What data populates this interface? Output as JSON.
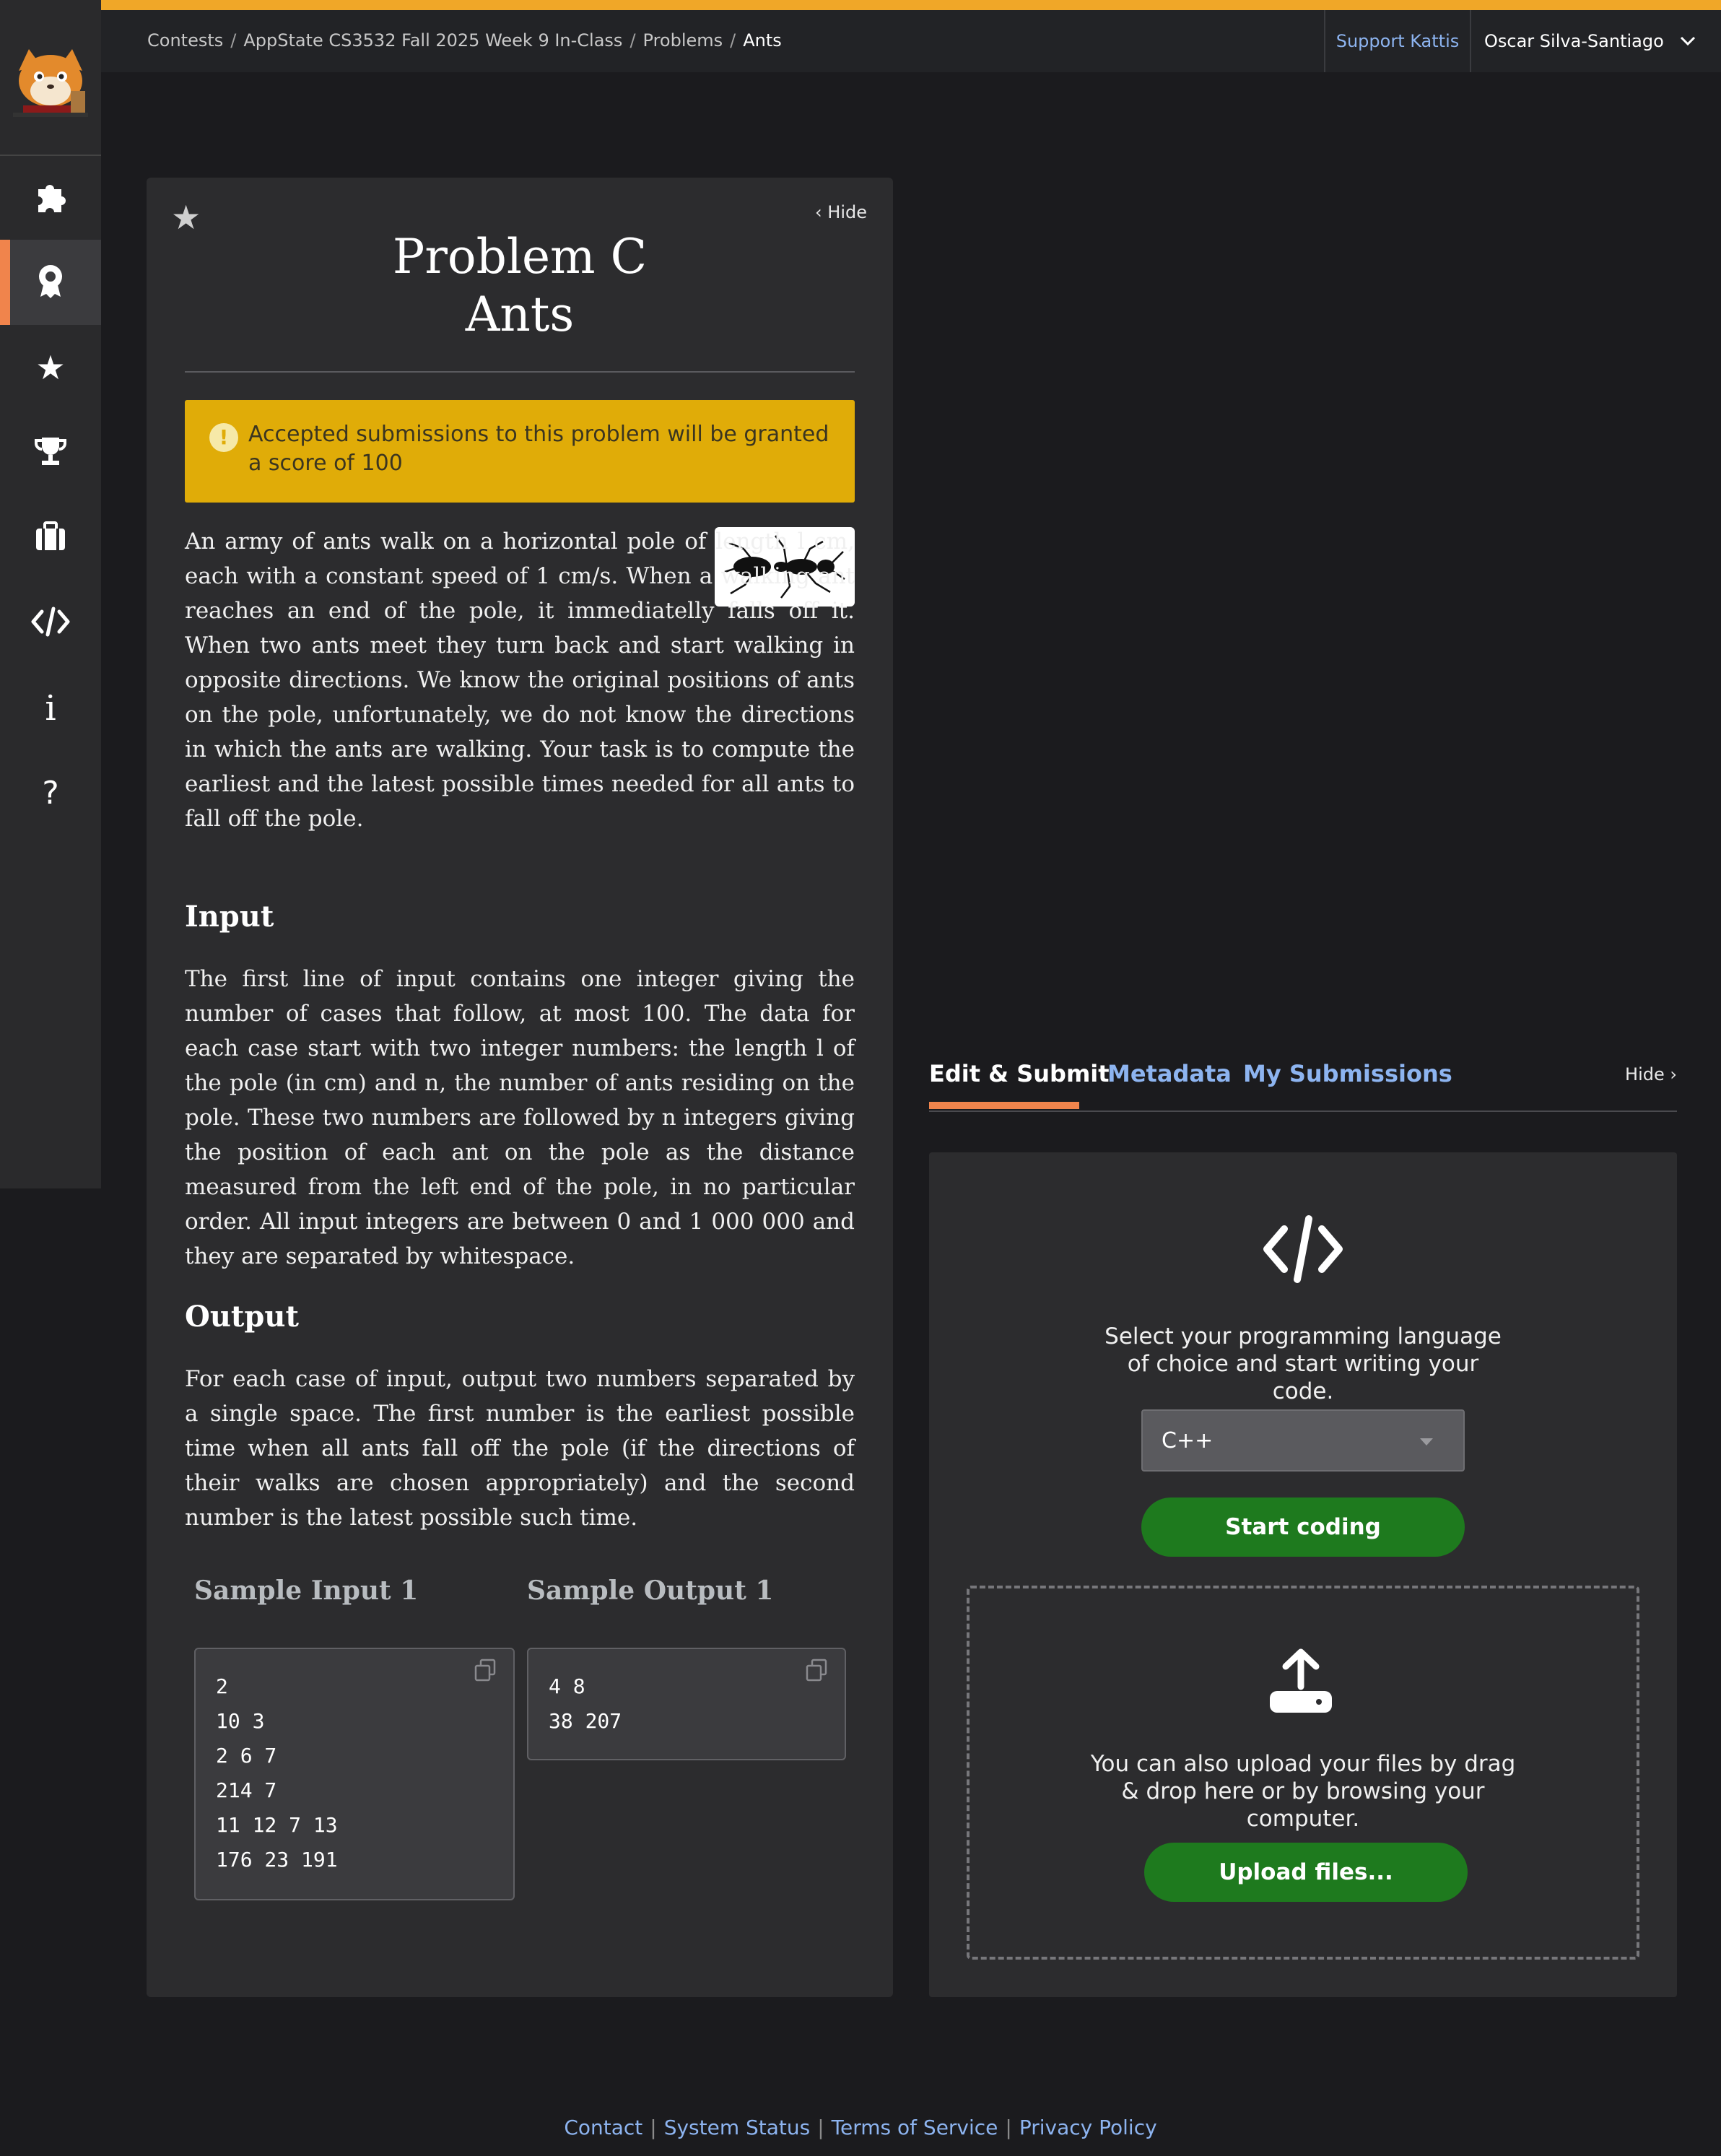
{
  "header": {
    "breadcrumbs": [
      "Contests",
      "AppState CS3532 Fall 2025 Week 9 In-Class",
      "Problems",
      "Ants"
    ],
    "support_label": "Support Kattis",
    "user_name": "Oscar Silva-Santiago",
    "accent_color": "#f0a728"
  },
  "sidebar": {
    "items": [
      {
        "icon": "puzzle-icon",
        "active": false
      },
      {
        "icon": "badge-icon",
        "active": true
      },
      {
        "icon": "star-icon",
        "active": false
      },
      {
        "icon": "trophy-icon",
        "active": false
      },
      {
        "icon": "briefcase-icon",
        "active": false
      },
      {
        "icon": "code-icon",
        "active": false
      },
      {
        "icon": "info-icon",
        "active": false
      },
      {
        "icon": "help-icon",
        "active": false
      }
    ]
  },
  "problem": {
    "hide_label": "Hide",
    "title_line1": "Problem C",
    "title_line2": "Ants",
    "alert_text": "Accepted submissions to this problem will be granted a score of 100",
    "description": "An army of ants walk on a horizontal pole of length l cm, each with a constant speed of 1 cm/s. When a walking ant reaches an end of the pole, it immediatelly falls off it. When two ants meet they turn back and start walking in opposite directions. We know the original positions of ants on the pole, unfortunately, we do not know the directions in which the ants are walking. Your task is to compute the earliest and the latest possible times needed for all ants to fall off the pole.",
    "input_heading": "Input",
    "input_text": "The first line of input contains one integer giving the number of cases that follow, at most 100. The data for each case start with two integer numbers: the length l of the pole (in cm) and n, the number of ants residing on the pole. These two numbers are followed by n integers giving the position of each ant on the pole as the distance measured from the left end of the pole, in no particular order. All input integers are between 0 and 1 000 000 and they are separated by whitespace.",
    "output_heading": "Output",
    "output_text": "For each case of input, output two numbers separated by a single space. The first number is the earliest possible time when all ants fall off the pole (if the directions of their walks are chosen appropriately) and the second number is the latest possible such time.",
    "sample_input_label": "Sample Input 1",
    "sample_output_label": "Sample Output 1",
    "sample_input_lines": [
      "2",
      "10 3",
      "2 6 7",
      "214 7",
      "11 12 7 13",
      "176 23 191"
    ],
    "sample_output_lines": [
      "4 8",
      "38 207"
    ]
  },
  "editor": {
    "tabs": [
      "Edit & Submit",
      "Metadata",
      "My Submissions"
    ],
    "hide_label": "Hide",
    "prompt_text": "Select your programming language of choice and start writing your code.",
    "language_value": "C++",
    "start_label": "Start coding",
    "upload_text": "You can also upload your files by drag & drop here or by browsing your computer.",
    "upload_label": "Upload files...",
    "button_color": "#1e7a1e"
  },
  "footer": {
    "links": [
      "Contact",
      "System Status",
      "Terms of Service",
      "Privacy Policy"
    ]
  }
}
